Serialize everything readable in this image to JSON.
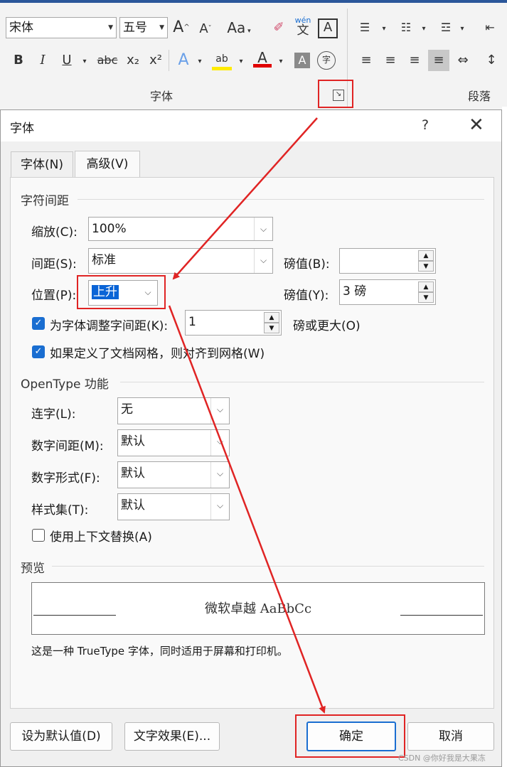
{
  "ribbon": {
    "font_name": "宋体",
    "font_size": "五号",
    "group_font_label": "字体",
    "group_paragraph_label": "段落",
    "btn_grow": "A",
    "btn_shrink": "A",
    "btn_case": "Aa",
    "btn_pinyin_top": "wén",
    "btn_pinyin_bottom": "文",
    "btn_border_char": "A",
    "btn_bold": "B",
    "btn_italic": "I",
    "btn_underline": "U",
    "btn_strike": "abc",
    "btn_sub": "x₂",
    "btn_sup": "x²",
    "btn_effects": "A",
    "btn_highlight": "ab",
    "btn_color": "A",
    "btn_shade": "A",
    "btn_enclose": "字",
    "colors": {
      "accent": "#2b579a",
      "highlight": "#ffeb00",
      "font_color": "#e00000"
    }
  },
  "dialog": {
    "title": "字体",
    "help": "?",
    "close": "✕",
    "tabs": [
      {
        "label": "字体(N)"
      },
      {
        "label": "高级(V)"
      }
    ],
    "spacing_section": {
      "title": "字符间距",
      "scale_label": "缩放(C):",
      "scale_value": "100%",
      "spacing_label": "间距(S):",
      "spacing_value": "标准",
      "spacing_pt_label": "磅值(B):",
      "spacing_pt_value": "",
      "position_label": "位置(P):",
      "position_value": "上升",
      "position_pt_label": "磅值(Y):",
      "position_pt_value": "3 磅",
      "kerning_label": "为字体调整字间距(K):",
      "kerning_checked": true,
      "kerning_value": "1",
      "kerning_suffix": "磅或更大(O)",
      "grid_label": "如果定义了文档网格，则对齐到网格(W)",
      "grid_checked": true
    },
    "opentype_section": {
      "title": "OpenType 功能",
      "ligature_label": "连字(L):",
      "ligature_value": "无",
      "numspacing_label": "数字间距(M):",
      "numspacing_value": "默认",
      "numform_label": "数字形式(F):",
      "numform_value": "默认",
      "styleset_label": "样式集(T):",
      "styleset_value": "默认",
      "contextual_label": "使用上下文替换(A)",
      "contextual_checked": false
    },
    "preview_section": {
      "title": "预览",
      "sample": "微软卓越  AaBbCc",
      "note": "这是一种 TrueType 字体，同时适用于屏幕和打印机。"
    },
    "buttons": {
      "set_default": "设为默认值(D)",
      "text_effects": "文字效果(E)...",
      "ok": "确定",
      "cancel": "取消"
    }
  },
  "watermark": "CSDN @你好我是大果冻",
  "annotation_color": "#e02424"
}
